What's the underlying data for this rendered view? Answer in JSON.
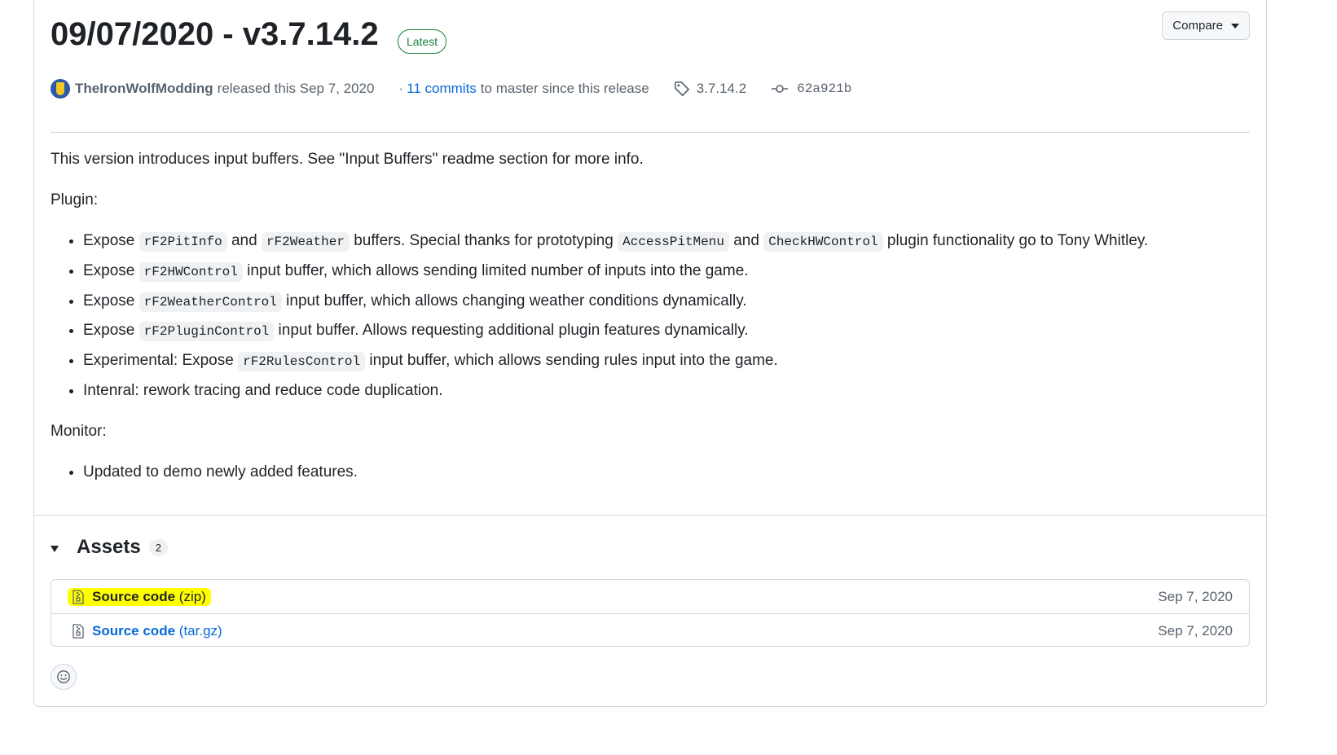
{
  "release": {
    "title": "09/07/2020 - v3.7.14.2",
    "badge": "Latest",
    "compare_label": "Compare"
  },
  "meta": {
    "author": "TheIronWolfModding",
    "released_text": "released this Sep 7, 2020",
    "dot": "·",
    "commits_link": "11 commits",
    "commits_suffix": "to master since this release",
    "tag": "3.7.14.2",
    "commit_hash": "62a921b"
  },
  "notes": {
    "intro": "This version introduces input buffers. See \"Input Buffers\" readme section for more info.",
    "plugin_heading": "Plugin:",
    "plugin_items": [
      {
        "t1": "Expose ",
        "c1": "rF2PitInfo",
        "t2": " and ",
        "c2": "rF2Weather",
        "t3": " buffers. Special thanks for prototyping ",
        "c3": "AccessPitMenu",
        "t4": " and ",
        "c4": "CheckHWControl",
        "t5": " plugin functionality go to Tony Whitley."
      },
      {
        "t1": "Expose ",
        "c1": "rF2HWControl",
        "t2": " input buffer, which allows sending limited number of inputs into the game."
      },
      {
        "t1": "Expose ",
        "c1": "rF2WeatherControl",
        "t2": " input buffer, which allows changing weather conditions dynamically."
      },
      {
        "t1": "Expose ",
        "c1": "rF2PluginControl",
        "t2": " input buffer. Allows requesting additional plugin features dynamically."
      },
      {
        "t1": "Experimental: Expose ",
        "c1": "rF2RulesControl",
        "t2": " input buffer, which allows sending rules input into the game."
      },
      {
        "t1": "Intenral: rework tracing and reduce code duplication."
      }
    ],
    "monitor_heading": "Monitor:",
    "monitor_items": [
      "Updated to demo newly added features."
    ]
  },
  "assets": {
    "title": "Assets",
    "count": "2",
    "items": [
      {
        "name": "Source code",
        "ext": "(zip)",
        "date": "Sep 7, 2020",
        "highlighted": true
      },
      {
        "name": "Source code",
        "ext": "(tar.gz)",
        "date": "Sep 7, 2020",
        "highlighted": false
      }
    ]
  },
  "colors": {
    "link": "#0969da",
    "latest_badge": "#1a7f37",
    "highlight": "#ffff00",
    "border": "#d0d7de"
  },
  "icons": {
    "tag": "tag-icon",
    "commit": "git-commit-icon",
    "zip": "file-zip-icon",
    "emoji": "smiley-icon",
    "caret": "triangle-down-icon"
  }
}
